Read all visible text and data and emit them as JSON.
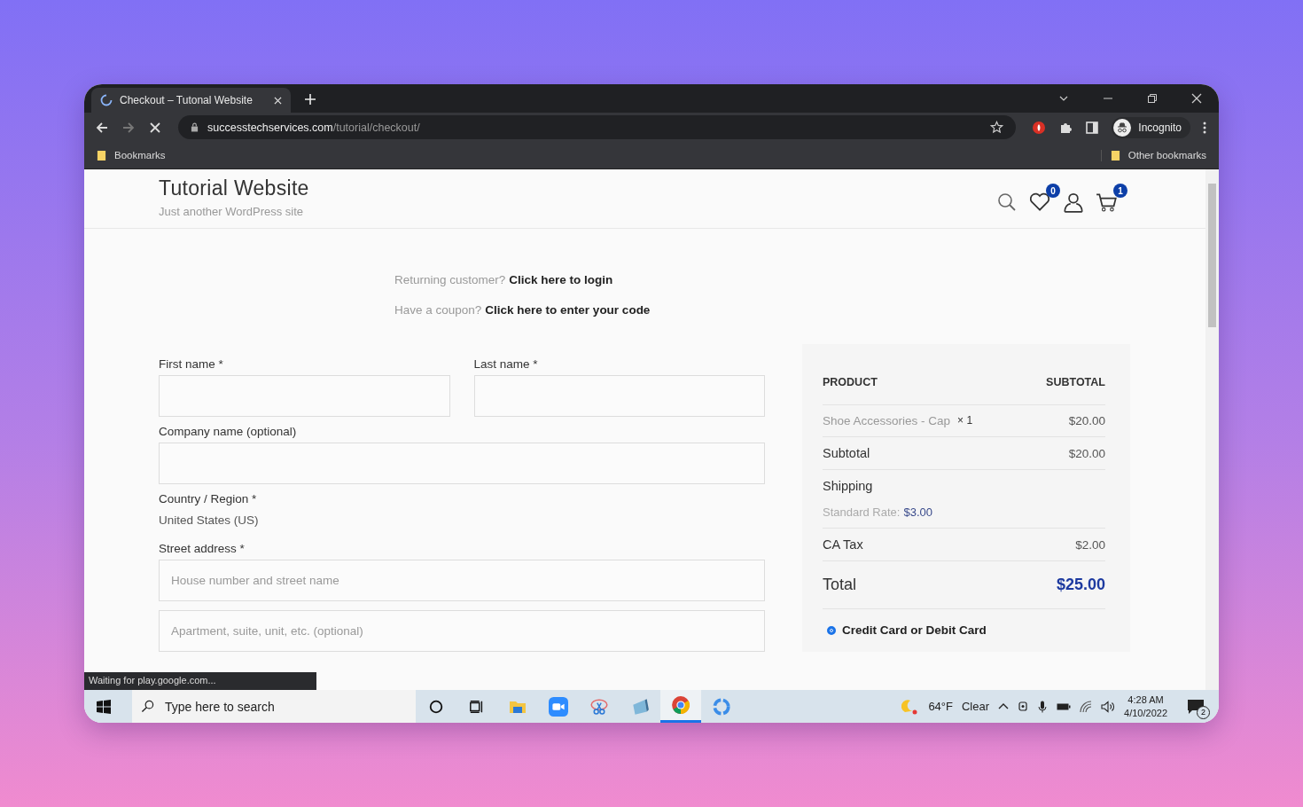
{
  "browser": {
    "tab_title": "Checkout – Tutonal Website",
    "url_host": "successtechservices.com",
    "url_path": "/tutorial/checkout/",
    "profile": "Incognito",
    "bookmarks": "Bookmarks",
    "other_bookmarks": "Other bookmarks",
    "status": "Waiting for play.google.com..."
  },
  "site": {
    "title": "Tutorial Website",
    "tagline": "Just another WordPress site",
    "wishlist_count": "0",
    "cart_count": "1"
  },
  "notices": [
    {
      "text": "Returning customer?",
      "link": "Click here to login"
    },
    {
      "text": "Have a coupon?",
      "link": "Click here to enter your code"
    }
  ],
  "form": {
    "first_name": {
      "label": "First name *"
    },
    "last_name": {
      "label": "Last name *"
    },
    "company": {
      "label": "Company name (optional)"
    },
    "country": {
      "label": "Country / Region *",
      "value": "United States (US)"
    },
    "street": {
      "label": "Street address *",
      "placeholder": "House number and street name"
    },
    "street2": {
      "placeholder": "Apartment, suite, unit, etc. (optional)"
    }
  },
  "order": {
    "columns": [
      "PRODUCT",
      "SUBTOTAL"
    ],
    "item": {
      "name": "Shoe Accessories - Cap",
      "qty": "× 1",
      "price": "$20.00"
    },
    "subtotal": {
      "label": "Subtotal",
      "value": "$20.00"
    },
    "shipping": {
      "label": "Shipping",
      "rate_label": "Standard Rate:",
      "rate": "$3.00"
    },
    "tax": {
      "label": "CA Tax",
      "value": "$2.00"
    },
    "total": {
      "label": "Total",
      "value": "$25.00"
    },
    "payment_methods": [
      {
        "label": "Credit Card or Debit Card",
        "selected": true
      }
    ]
  },
  "taskbar": {
    "search_placeholder": "Type here to search",
    "apps": [
      {
        "kind": "cortana",
        "selected": false
      },
      {
        "kind": "taskview",
        "selected": false
      },
      {
        "kind": "files",
        "selected": false
      },
      {
        "kind": "video",
        "selected": false
      },
      {
        "kind": "snip",
        "selected": false
      },
      {
        "kind": "app",
        "selected": false
      },
      {
        "kind": "chrome",
        "selected": true
      },
      {
        "kind": "cloud",
        "selected": false
      }
    ],
    "weather": "64°F",
    "weather_text": "Clear",
    "time": "4:28 AM",
    "date": "4/10/2022",
    "notifications": "2"
  }
}
